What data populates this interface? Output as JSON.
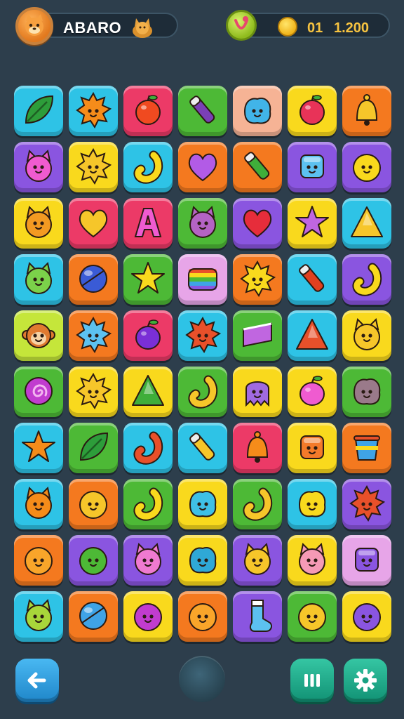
{
  "header": {
    "player_name": "ABARO",
    "coin_level": "01",
    "coin_count": "1.200"
  },
  "palette": {
    "cyan": "#2ec3e6",
    "orange": "#f4791f",
    "pink": "#ec3a67",
    "green": "#4db936",
    "peach": "#f6b395",
    "yellow": "#f9d91d",
    "purple": "#8a55e0",
    "lime": "#c5e63a",
    "lavender": "#e7a5e8"
  },
  "board": {
    "rows": [
      [
        {
          "name": "leaf-icon",
          "bg": "cyan",
          "c": "#2d9d3a"
        },
        {
          "name": "sun-icon",
          "bg": "cyan",
          "c": "#f58c1a"
        },
        {
          "name": "apple-icon",
          "bg": "pink",
          "c": "#f04a20"
        },
        {
          "name": "stick-icon",
          "bg": "green",
          "c": "#7a3fb6"
        },
        {
          "name": "blob-icon",
          "bg": "peach",
          "c": "#41b4e8"
        },
        {
          "name": "apple-icon",
          "bg": "yellow",
          "c": "#e83358"
        },
        {
          "name": "bell-icon",
          "bg": "orange",
          "c": "#f6c62a"
        }
      ],
      [
        {
          "name": "cat-icon",
          "bg": "purple",
          "c": "#ef5bd0"
        },
        {
          "name": "sun-icon",
          "bg": "yellow",
          "c": "#f6c62a"
        },
        {
          "name": "hook-icon",
          "bg": "cyan",
          "c": "#f9d91d"
        },
        {
          "name": "heart-icon",
          "bg": "orange",
          "c": "#b25be6"
        },
        {
          "name": "stick-icon",
          "bg": "orange",
          "c": "#3fae3a"
        },
        {
          "name": "cube-icon",
          "bg": "purple",
          "c": "#5cc1f0"
        },
        {
          "name": "face-icon",
          "bg": "purple",
          "c": "#f9d91d"
        }
      ],
      [
        {
          "name": "cat-icon",
          "bg": "yellow",
          "c": "#f39a22"
        },
        {
          "name": "heart-icon",
          "bg": "pink",
          "c": "#f6c62a"
        },
        {
          "name": "letter-a-icon",
          "bg": "pink",
          "c": "#ef5bd0"
        },
        {
          "name": "cat-icon",
          "bg": "green",
          "c": "#b463c4"
        },
        {
          "name": "heart-icon",
          "bg": "purple",
          "c": "#e62d3b"
        },
        {
          "name": "star-icon",
          "bg": "yellow",
          "c": "#c066e0"
        },
        {
          "name": "triangle-icon",
          "bg": "cyan",
          "c": "#f6c62a"
        }
      ],
      [
        {
          "name": "cat-icon",
          "bg": "cyan",
          "c": "#7bd14a"
        },
        {
          "name": "ball-icon",
          "bg": "orange",
          "c": "#3a5bd6"
        },
        {
          "name": "star-icon",
          "bg": "green",
          "c": "#f9d91d"
        },
        {
          "name": "rainbow-icon",
          "bg": "lavender",
          "c": "#3fa3e6"
        },
        {
          "name": "sun-icon",
          "bg": "orange",
          "c": "#f9d91d"
        },
        {
          "name": "stick-icon",
          "bg": "cyan",
          "c": "#e0401f"
        },
        {
          "name": "hook-icon",
          "bg": "purple",
          "c": "#f9d91d"
        }
      ],
      [
        {
          "name": "monkey-icon",
          "bg": "lime",
          "c": "#e07a30"
        },
        {
          "name": "sun-icon",
          "bg": "orange",
          "c": "#5cc1f0"
        },
        {
          "name": "plum-icon",
          "bg": "pink",
          "c": "#7a2fd6"
        },
        {
          "name": "sun-icon",
          "bg": "cyan",
          "c": "#e8502a"
        },
        {
          "name": "drum-icon",
          "bg": "green",
          "c": "#c066e0"
        },
        {
          "name": "triangle-icon",
          "bg": "cyan",
          "c": "#e8502a"
        },
        {
          "name": "cat-icon",
          "bg": "yellow",
          "c": "#f6c62a"
        }
      ],
      [
        {
          "name": "swirl-icon",
          "bg": "green",
          "c": "#c13ccf"
        },
        {
          "name": "sun-icon",
          "bg": "yellow",
          "c": "#f6c62a"
        },
        {
          "name": "triangle-icon",
          "bg": "yellow",
          "c": "#3fae3a"
        },
        {
          "name": "hook-icon",
          "bg": "green",
          "c": "#f6c62a"
        },
        {
          "name": "monster-icon",
          "bg": "yellow",
          "c": "#a06ae0"
        },
        {
          "name": "plum-icon",
          "bg": "yellow",
          "c": "#ef5bd0"
        },
        {
          "name": "blob-icon",
          "bg": "green",
          "c": "#9a7a8a"
        }
      ],
      [
        {
          "name": "star-icon",
          "bg": "cyan",
          "c": "#f58c1a"
        },
        {
          "name": "leaf-icon",
          "bg": "green",
          "c": "#2d9d3a"
        },
        {
          "name": "hook-icon",
          "bg": "cyan",
          "c": "#e8502a"
        },
        {
          "name": "stick-icon",
          "bg": "cyan",
          "c": "#f6c62a"
        },
        {
          "name": "bell-icon",
          "bg": "pink",
          "c": "#f58c1a"
        },
        {
          "name": "cube-icon",
          "bg": "yellow",
          "c": "#f47a2a"
        },
        {
          "name": "bucket-icon",
          "bg": "orange",
          "c": "#3fa3e6"
        }
      ],
      [
        {
          "name": "cat-icon",
          "bg": "cyan",
          "c": "#f58c1a"
        },
        {
          "name": "face-icon",
          "bg": "orange",
          "c": "#f6c62a"
        },
        {
          "name": "hook-icon",
          "bg": "green",
          "c": "#f9d91d"
        },
        {
          "name": "blob-icon",
          "bg": "yellow",
          "c": "#3fc0e6"
        },
        {
          "name": "hook-icon",
          "bg": "green",
          "c": "#f6c62a"
        },
        {
          "name": "blob-icon",
          "bg": "cyan",
          "c": "#f9d91d"
        },
        {
          "name": "sun-icon",
          "bg": "purple",
          "c": "#e8502a"
        }
      ],
      [
        {
          "name": "face-icon",
          "bg": "orange",
          "c": "#f9a52a"
        },
        {
          "name": "face-icon",
          "bg": "purple",
          "c": "#4db936"
        },
        {
          "name": "cat-icon",
          "bg": "purple",
          "c": "#ef7ad0"
        },
        {
          "name": "blob-icon",
          "bg": "yellow",
          "c": "#2fa8d6"
        },
        {
          "name": "cat-icon",
          "bg": "purple",
          "c": "#f6c62a"
        },
        {
          "name": "cat-icon",
          "bg": "yellow",
          "c": "#f59ab6"
        },
        {
          "name": "cube-icon",
          "bg": "lavender",
          "c": "#8a55e0"
        }
      ],
      [
        {
          "name": "cat-icon",
          "bg": "cyan",
          "c": "#a8d63a"
        },
        {
          "name": "ball-icon",
          "bg": "orange",
          "c": "#3fa3e6"
        },
        {
          "name": "face-icon",
          "bg": "yellow",
          "c": "#c13ccf"
        },
        {
          "name": "face-icon",
          "bg": "orange",
          "c": "#f9a52a"
        },
        {
          "name": "sock-icon",
          "bg": "purple",
          "c": "#5cc1f0"
        },
        {
          "name": "face-icon",
          "bg": "green",
          "c": "#f6c62a"
        },
        {
          "name": "face-icon",
          "bg": "yellow",
          "c": "#8a55e0"
        }
      ]
    ]
  },
  "footer": {
    "back": "back-arrow-icon",
    "menu": "pause-icon",
    "settings": "gear-icon"
  }
}
